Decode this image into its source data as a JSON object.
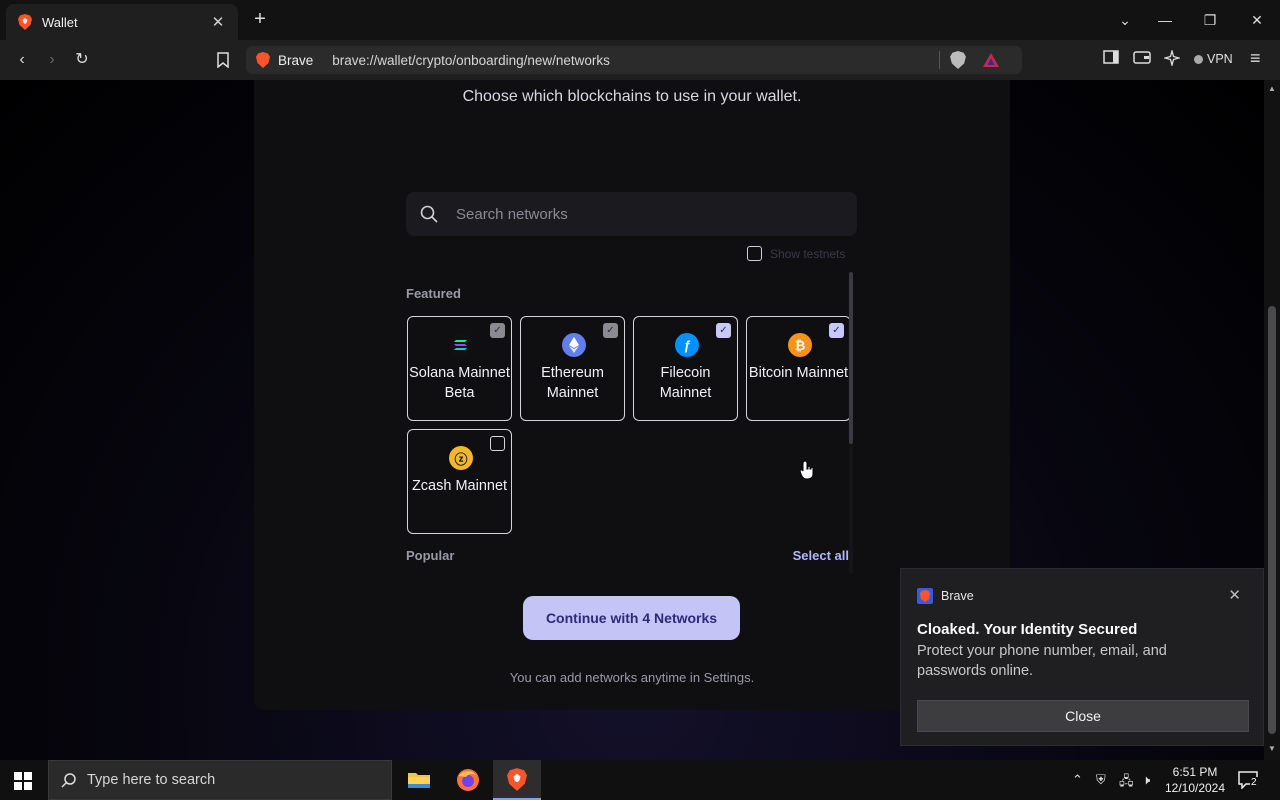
{
  "browser": {
    "tab_title": "Wallet",
    "site_label": "Brave",
    "url": "brave://wallet/crypto/onboarding/new/networks",
    "vpn_label": "VPN"
  },
  "page": {
    "subtitle": "Choose which blockchains to use in your wallet.",
    "search_placeholder": "Search networks",
    "show_testnets_label": "Show testnets",
    "featured_label": "Featured",
    "popular_label": "Popular",
    "select_all_label": "Select all",
    "networks": [
      {
        "name": "Solana Mainnet Beta",
        "state": "locked-checked",
        "icon": "solana-icon",
        "color": "#111111"
      },
      {
        "name": "Ethereum Mainnet",
        "state": "locked-checked",
        "icon": "ethereum-icon",
        "color": "#627eea"
      },
      {
        "name": "Filecoin Mainnet",
        "state": "checked",
        "icon": "filecoin-icon",
        "color": "#0090ff"
      },
      {
        "name": "Bitcoin Mainnet",
        "state": "checked",
        "icon": "bitcoin-icon",
        "color": "#f7931a"
      },
      {
        "name": "Zcash Mainnet",
        "state": "unchecked",
        "icon": "zcash-icon",
        "color": "#f4b728"
      }
    ],
    "continue_label": "Continue with 4 Networks",
    "footnote": "You can add networks anytime in Settings."
  },
  "toast": {
    "app_name": "Brave",
    "title": "Cloaked. Your Identity Secured",
    "body": "Protect your phone number, email, and passwords online.",
    "close_label": "Close"
  },
  "taskbar": {
    "search_placeholder": "Type here to search",
    "time": "6:51 PM",
    "date": "12/10/2024",
    "notification_count": "2"
  }
}
